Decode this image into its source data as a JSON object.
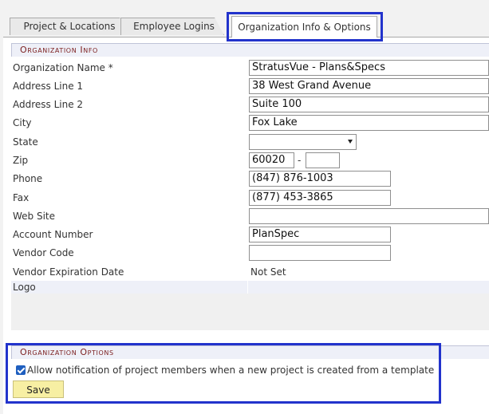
{
  "tabs": [
    {
      "label": "Project & Locations"
    },
    {
      "label": "Employee Logins"
    },
    {
      "label": "Organization Info & Options"
    }
  ],
  "organization_info": {
    "header": "Organization Info",
    "fields": {
      "org_name": {
        "label": "Organization Name  *",
        "value": "StratusVue - Plans&Specs"
      },
      "address1": {
        "label": "Address Line 1",
        "value": "38 West Grand Avenue"
      },
      "address2": {
        "label": "Address Line 2",
        "value": "Suite 100"
      },
      "city": {
        "label": "City",
        "value": "Fox Lake"
      },
      "state": {
        "label": "State",
        "value": ""
      },
      "zip": {
        "label": "Zip",
        "value": "60020",
        "ext_value": "",
        "separator": "-"
      },
      "phone": {
        "label": "Phone",
        "value": "(847) 876-1003"
      },
      "fax": {
        "label": "Fax",
        "value": "(877) 453-3865"
      },
      "website": {
        "label": "Web Site",
        "value": ""
      },
      "account_number": {
        "label": "Account Number",
        "value": "PlanSpec"
      },
      "vendor_code": {
        "label": "Vendor Code",
        "value": ""
      },
      "vendor_expiration": {
        "label": "Vendor Expiration Date",
        "value": "Not Set"
      },
      "logo": {
        "label": "Logo"
      }
    }
  },
  "organization_options": {
    "header": "Organization Options",
    "notify_checkbox": {
      "checked": true,
      "label": "Allow notification of project members when a new project is created from a template"
    },
    "save_label": "Save"
  },
  "colors": {
    "section_header_text": "#7b1d1d",
    "section_header_bg": "#eef0f8",
    "highlight_border": "#2233cc",
    "save_button_bg": "#f7efa3",
    "checkbox_accent": "#1f5fbf"
  }
}
